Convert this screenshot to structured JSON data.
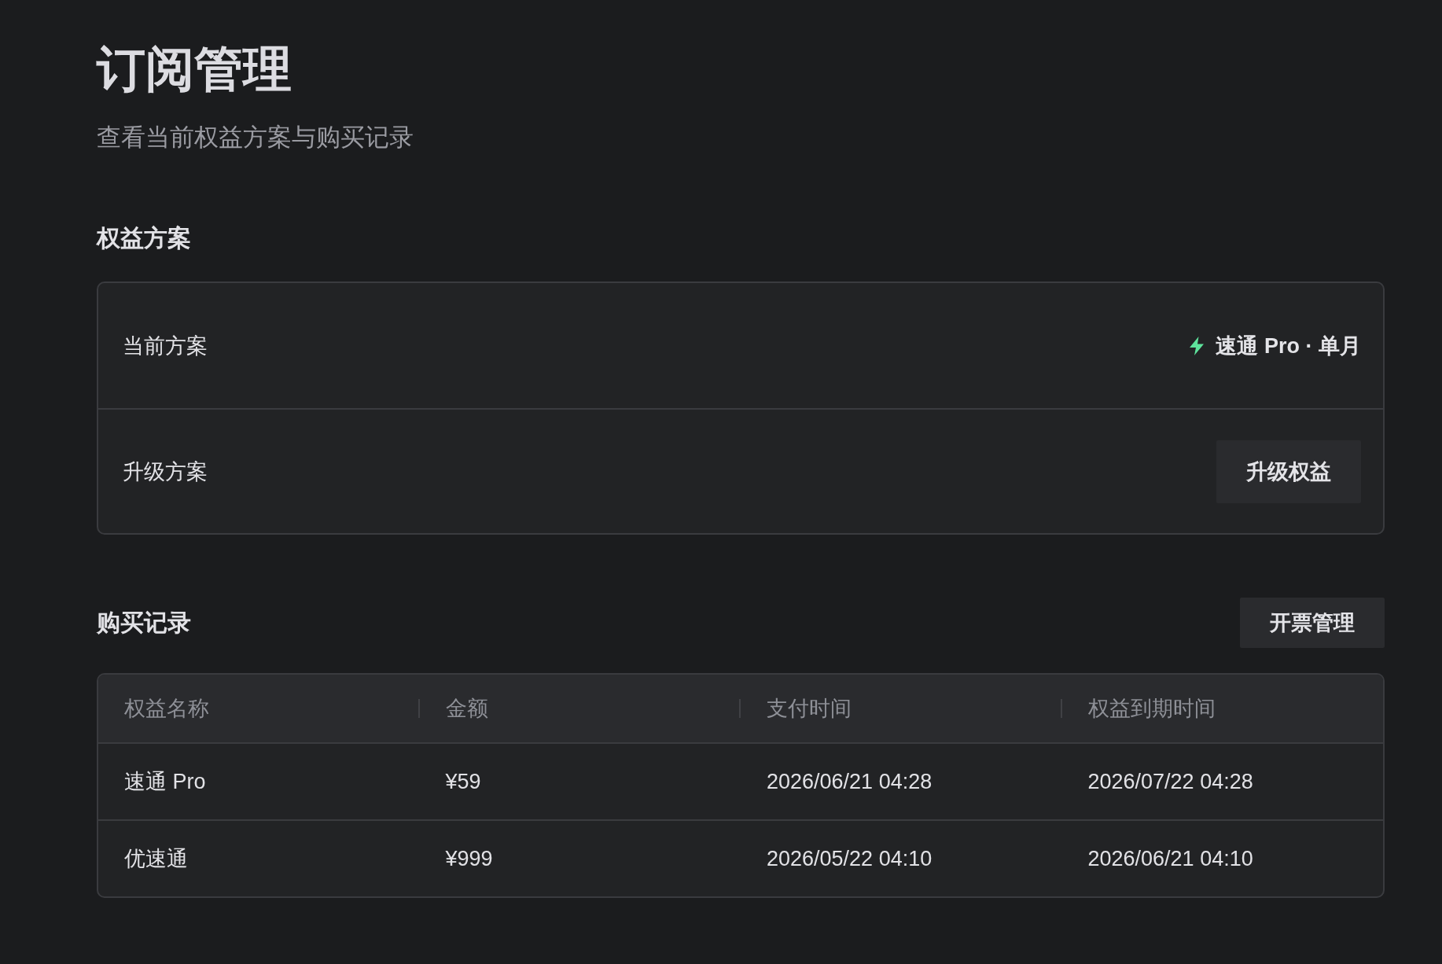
{
  "page": {
    "title": "订阅管理",
    "subtitle": "查看当前权益方案与购买记录"
  },
  "plan_section": {
    "heading": "权益方案",
    "rows": [
      {
        "kind": "value",
        "label": "当前方案",
        "value": "速通 Pro · 单月"
      },
      {
        "kind": "button",
        "label": "升级方案",
        "button": "升级权益"
      }
    ]
  },
  "purchases": {
    "heading": "购买记录",
    "button": "开票管理",
    "table": {
      "columns": [
        "权益名称",
        "金额",
        "支付时间",
        "权益到期时间"
      ],
      "rows": [
        [
          "速通 Pro",
          "¥59",
          "2026/06/21 04:28",
          "2026/07/22 04:28"
        ],
        [
          "优速通",
          "¥999",
          "2026/05/22 04:10",
          "2026/06/21 04:10"
        ]
      ]
    }
  }
}
